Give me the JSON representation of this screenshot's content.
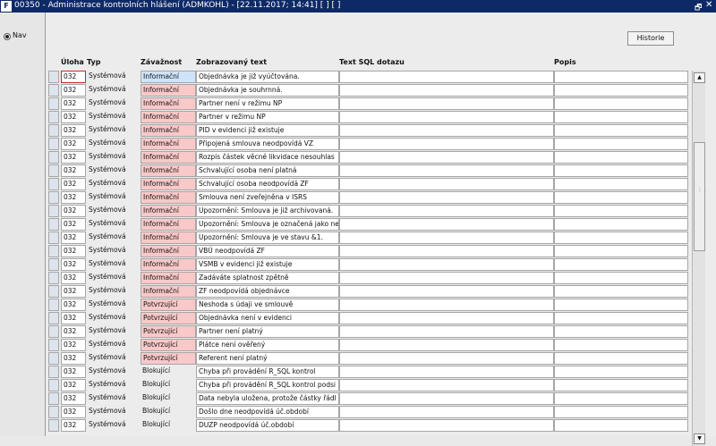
{
  "window": {
    "icon_text": "F",
    "title": "00350 - Administrace kontrolních hlášení (ADMKOHL) - [22.11.2017; 14:41]  [ ]  [ ]",
    "restore_glyph": "🗗",
    "close_glyph": "✕"
  },
  "sidebar": {
    "nav_label": "Nav"
  },
  "toolbar": {
    "historie_label": "Historie"
  },
  "columns": {
    "uloha": "Úloha",
    "typ": "Typ",
    "zavaznost": "Závažnost",
    "text": "Zobrazovaný text",
    "sql": "Text SQL dotazu",
    "popis": "Popis"
  },
  "severity_colors": {
    "informacni": "#f9c8c8",
    "informacni_selected": "#cfe3fb",
    "potvrzujici": "#f9c8c8"
  },
  "rows": [
    {
      "uloha": "032",
      "typ": "Systémová",
      "zavaznost": "Informační",
      "text": "Objednávka je již vyúčtována.",
      "sql": "",
      "popis": ""
    },
    {
      "uloha": "032",
      "typ": "Systémová",
      "zavaznost": "Informační",
      "text": "Objednávka je souhrnná.",
      "sql": "",
      "popis": ""
    },
    {
      "uloha": "032",
      "typ": "Systémová",
      "zavaznost": "Informační",
      "text": "Partner není v režimu NP",
      "sql": "",
      "popis": ""
    },
    {
      "uloha": "032",
      "typ": "Systémová",
      "zavaznost": "Informační",
      "text": "Partner v režimu NP",
      "sql": "",
      "popis": ""
    },
    {
      "uloha": "032",
      "typ": "Systémová",
      "zavaznost": "Informační",
      "text": "PID v evidenci již existuje",
      "sql": "",
      "popis": ""
    },
    {
      "uloha": "032",
      "typ": "Systémová",
      "zavaznost": "Informační",
      "text": "Připojená smlouva neodpovídá VZ",
      "sql": "",
      "popis": ""
    },
    {
      "uloha": "032",
      "typ": "Systémová",
      "zavaznost": "Informační",
      "text": "Rozpis částek věcné likvidace nesouhlas",
      "sql": "",
      "popis": ""
    },
    {
      "uloha": "032",
      "typ": "Systémová",
      "zavaznost": "Informační",
      "text": "Schvalující osoba není platná",
      "sql": "",
      "popis": ""
    },
    {
      "uloha": "032",
      "typ": "Systémová",
      "zavaznost": "Informační",
      "text": "Schvalující osoba neodpovídá ZF",
      "sql": "",
      "popis": ""
    },
    {
      "uloha": "032",
      "typ": "Systémová",
      "zavaznost": "Informační",
      "text": "Smlouva není zveřejněna v ISRS",
      "sql": "",
      "popis": ""
    },
    {
      "uloha": "032",
      "typ": "Systémová",
      "zavaznost": "Informační",
      "text": "Upozornění: Smlouva je již archivovaná.",
      "sql": "",
      "popis": ""
    },
    {
      "uloha": "032",
      "typ": "Systémová",
      "zavaznost": "Informační",
      "text": "Upozornění: Smlouva je označená jako ne",
      "sql": "",
      "popis": ""
    },
    {
      "uloha": "032",
      "typ": "Systémová",
      "zavaznost": "Informační",
      "text": "Upozornění: Smlouva je ve stavu &1.",
      "sql": "",
      "popis": ""
    },
    {
      "uloha": "032",
      "typ": "Systémová",
      "zavaznost": "Informační",
      "text": "VBÚ neodpovídá ZF",
      "sql": "",
      "popis": ""
    },
    {
      "uloha": "032",
      "typ": "Systémová",
      "zavaznost": "Informační",
      "text": "VSMB v evidenci již existuje",
      "sql": "",
      "popis": ""
    },
    {
      "uloha": "032",
      "typ": "Systémová",
      "zavaznost": "Informační",
      "text": "Zadáváte splatnost zpětně",
      "sql": "",
      "popis": ""
    },
    {
      "uloha": "032",
      "typ": "Systémová",
      "zavaznost": "Informační",
      "text": "ZF neodpovídá objednávce",
      "sql": "",
      "popis": ""
    },
    {
      "uloha": "032",
      "typ": "Systémová",
      "zavaznost": "Potvrzující",
      "text": "Neshoda s údaji ve smlouvě",
      "sql": "",
      "popis": ""
    },
    {
      "uloha": "032",
      "typ": "Systémová",
      "zavaznost": "Potvrzující",
      "text": "Objednávka není v evidenci",
      "sql": "",
      "popis": ""
    },
    {
      "uloha": "032",
      "typ": "Systémová",
      "zavaznost": "Potvrzující",
      "text": "Partner není platný",
      "sql": "",
      "popis": ""
    },
    {
      "uloha": "032",
      "typ": "Systémová",
      "zavaznost": "Potvrzující",
      "text": "Plátce není ověřený",
      "sql": "",
      "popis": ""
    },
    {
      "uloha": "032",
      "typ": "Systémová",
      "zavaznost": "Potvrzující",
      "text": "Referent není platný",
      "sql": "",
      "popis": ""
    },
    {
      "uloha": "032",
      "typ": "Systémová",
      "zavaznost": "Blokující",
      "text": "Chyba při provádění R_SQL kontrol",
      "sql": "",
      "popis": ""
    },
    {
      "uloha": "032",
      "typ": "Systémová",
      "zavaznost": "Blokující",
      "text": "Chyba při provádění R_SQL kontrol podsi",
      "sql": "",
      "popis": ""
    },
    {
      "uloha": "032",
      "typ": "Systémová",
      "zavaznost": "Blokující",
      "text": "Data nebyla uložena, protože částky řádl",
      "sql": "",
      "popis": ""
    },
    {
      "uloha": "032",
      "typ": "Systémová",
      "zavaznost": "Blokující",
      "text": "Došlo dne neodpovídá úč.období",
      "sql": "",
      "popis": ""
    },
    {
      "uloha": "032",
      "typ": "Systémová",
      "zavaznost": "Blokující",
      "text": "DUZP neodpovídá úč.období",
      "sql": "",
      "popis": ""
    }
  ],
  "scrollbar": {
    "up_glyph": "▲",
    "down_glyph": "▼",
    "grip_glyph": "⋮⋮"
  }
}
